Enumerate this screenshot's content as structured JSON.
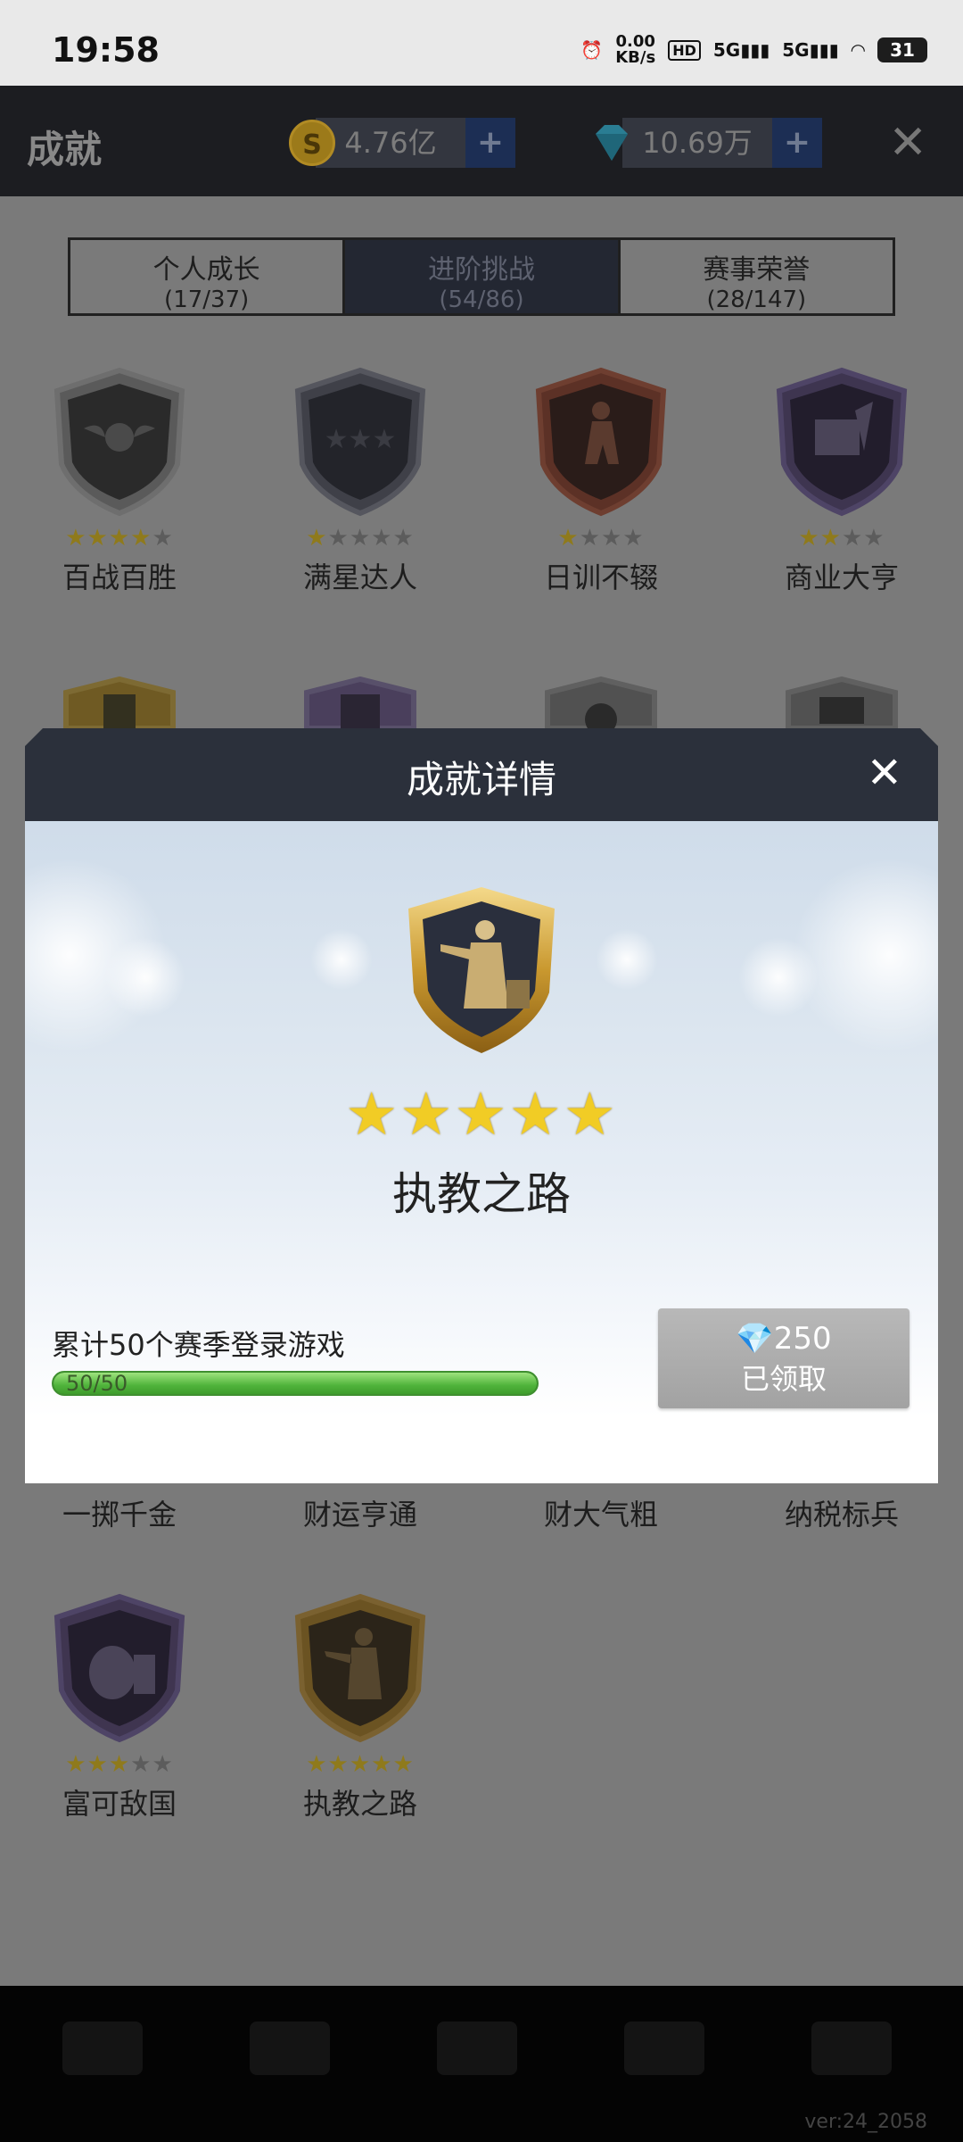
{
  "status_bar": {
    "time": "19:58",
    "net_speed": "0.00",
    "net_unit": "KB/s",
    "hd": "HD",
    "sig1": "5G",
    "sig2": "5G",
    "battery": "31"
  },
  "header": {
    "title": "成就",
    "coins": "4.76亿",
    "diamonds": "10.69万",
    "plus": "+",
    "close": "✕"
  },
  "tabs": [
    {
      "label": "个人成长",
      "count": "(17/37)"
    },
    {
      "label": "进阶挑战",
      "count": "(54/86)"
    },
    {
      "label": "赛事荣誉",
      "count": "(28/147)"
    }
  ],
  "achievements_row1": [
    {
      "name": "百战百胜",
      "stars": 4,
      "max": 5
    },
    {
      "name": "满星达人",
      "stars": 1,
      "max": 5
    },
    {
      "name": "日训不辍",
      "stars": 1,
      "max": 4
    },
    {
      "name": "商业大亨",
      "stars": 2,
      "max": 4
    }
  ],
  "achievements_row3": [
    {
      "name": "一掷千金"
    },
    {
      "name": "财运亨通"
    },
    {
      "name": "财大气粗"
    },
    {
      "name": "纳税标兵"
    }
  ],
  "achievements_row4": [
    {
      "name": "富可敌国",
      "stars": 3,
      "max": 5
    },
    {
      "name": "执教之路",
      "stars": 5,
      "max": 5
    }
  ],
  "modal": {
    "title": "成就详情",
    "close": "✕",
    "stars": "★★★★★",
    "achievement_name": "执教之路",
    "condition": "累计50个赛季登录游戏",
    "progress_text": "50/50",
    "progress_fraction": 1.0,
    "reward_amount": "250",
    "reward_status": "已领取"
  },
  "footer": {
    "version": "ver:24_2058"
  }
}
